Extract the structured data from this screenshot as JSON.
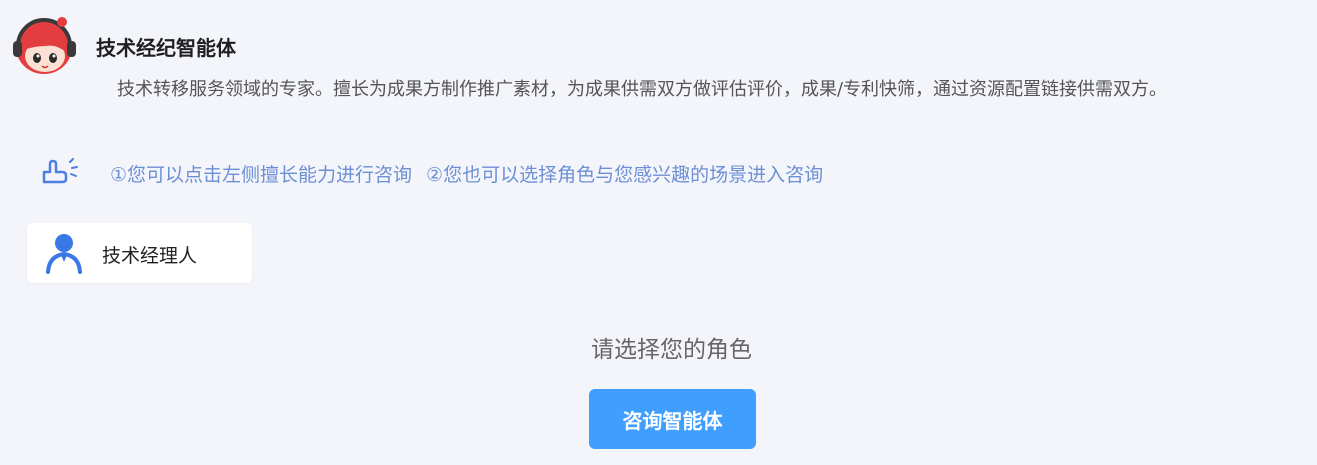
{
  "agent": {
    "name": "技术经纪智能体",
    "description": "技术转移服务领域的专家。擅长为成果方制作推广素材，为成果供需双方做评估评价，成果/专利快筛，通过资源配置链接供需双方。",
    "avatar_icon": "robot-girl-avatar-icon"
  },
  "hint": {
    "icon": "tap-hand-icon",
    "item1": "①您可以点击左侧擅长能力进行咨询",
    "item2": "②您也可以选择角色与您感兴趣的场景进入咨询"
  },
  "roles": [
    {
      "label": "技术经理人",
      "icon": "person-icon"
    }
  ],
  "main": {
    "prompt": "请选择您的角色",
    "consult_button": "咨询智能体"
  },
  "colors": {
    "background": "#f3f5fb",
    "accent": "#409eff",
    "hint_text": "#6d8fd4",
    "role_icon": "#3b78e7"
  }
}
